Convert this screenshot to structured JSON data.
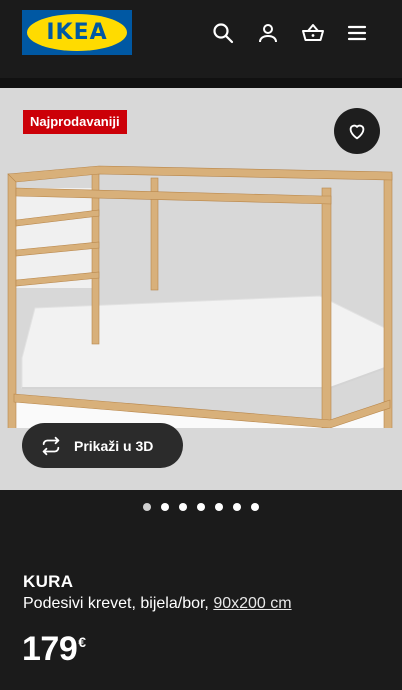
{
  "header": {
    "logo_text": "IKEA",
    "icons": [
      "search-icon",
      "user-icon",
      "basket-icon",
      "menu-icon"
    ]
  },
  "hero": {
    "badge": "Najprodavaniji",
    "view3d_label": "Prikaži u 3D",
    "carousel": {
      "count": 7,
      "active_index": 0
    }
  },
  "product": {
    "name": "KURA",
    "description": "Podesivi krevet, bijela/bor, ",
    "size": "90x200 cm",
    "price": "179",
    "currency": "€"
  },
  "colors": {
    "background": "#1b1b1b",
    "badge": "#cc0008",
    "logo_blue": "#0058a3",
    "logo_yellow": "#ffdb00",
    "hero_bg": "#d8d8d8"
  }
}
